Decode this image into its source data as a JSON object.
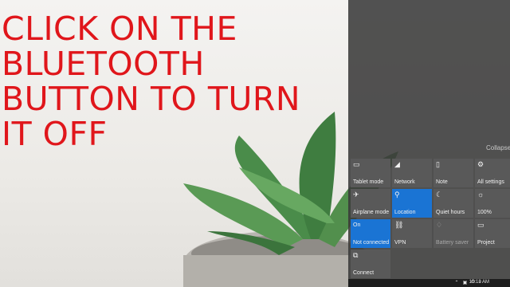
{
  "instruction": {
    "lines": [
      "CLICK ON THE",
      "BLUETOOTH",
      "BUTTON TO TURN",
      "IT OFF"
    ],
    "color": "#e0161b"
  },
  "action_center": {
    "collapse_label": "Collapse",
    "accent_color": "#1a74d4",
    "tiles": [
      {
        "label": "Tablet mode",
        "icon": "tablet-mode-icon",
        "active": false
      },
      {
        "label": "Network",
        "icon": "network-icon",
        "active": false
      },
      {
        "label": "Note",
        "icon": "note-icon",
        "active": false
      },
      {
        "label": "All settings",
        "icon": "gear-icon",
        "active": false
      },
      {
        "label": "Airplane mode",
        "icon": "airplane-icon",
        "active": false
      },
      {
        "label": "Location",
        "icon": "location-icon",
        "active": true
      },
      {
        "label": "Quiet hours",
        "icon": "moon-icon",
        "active": false
      },
      {
        "label": "100%",
        "icon": "brightness-icon",
        "active": false
      },
      {
        "label": "Not connected",
        "state": "On",
        "icon": "bluetooth-icon",
        "active": true
      },
      {
        "label": "VPN",
        "icon": "vpn-icon",
        "active": false
      },
      {
        "label": "Battery saver",
        "icon": "battery-saver-icon",
        "active": false,
        "disabled": true
      },
      {
        "label": "Project",
        "icon": "project-icon",
        "active": false
      },
      {
        "label": "Connect",
        "icon": "connect-icon",
        "active": false
      }
    ]
  },
  "taskbar": {
    "tray_icons": [
      "chevron-up-icon",
      "network-tray-icon",
      "power-icon",
      "volume-icon"
    ],
    "time": "10:18 AM"
  }
}
